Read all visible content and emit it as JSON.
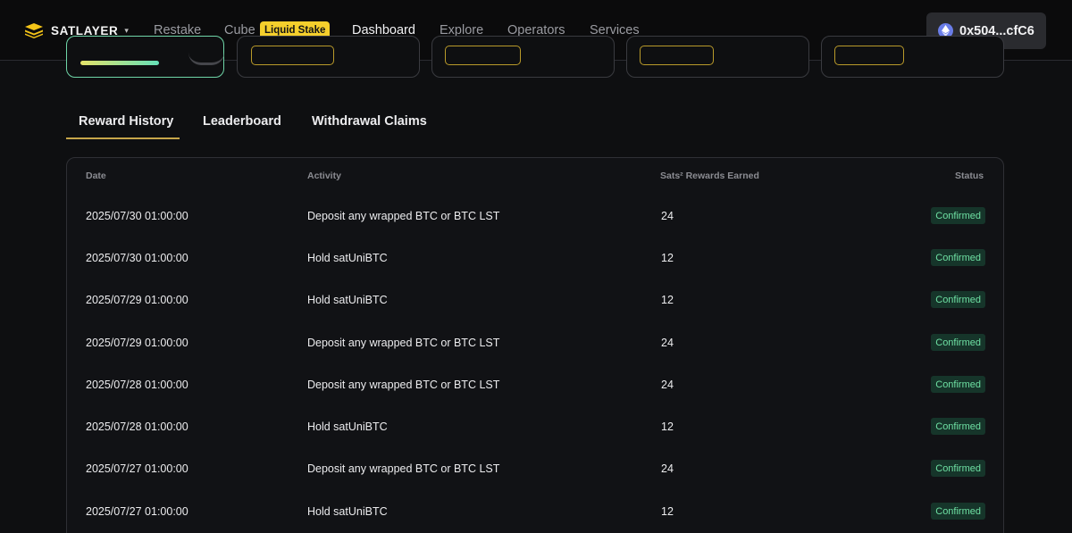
{
  "header": {
    "brand": "SATLAYER",
    "brand_caret": "▾",
    "nav": {
      "restake": "Restake",
      "cube": "Cube",
      "cube_badge": "Liquid Stake",
      "dashboard": "Dashboard",
      "explore": "Explore",
      "operators": "Operators",
      "services": "Services"
    },
    "wallet": "0x504...cfC6"
  },
  "tabs": {
    "reward_history": "Reward History",
    "leaderboard": "Leaderboard",
    "withdrawal_claims": "Withdrawal Claims"
  },
  "table": {
    "columns": {
      "date": "Date",
      "activity": "Activity",
      "rewards": "Sats² Rewards Earned",
      "status": "Status"
    },
    "rows": [
      {
        "date": "2025/07/30 01:00:00",
        "activity": "Deposit any wrapped BTC or BTC LST",
        "rewards": "24",
        "status": "Confirmed"
      },
      {
        "date": "2025/07/30 01:00:00",
        "activity": "Hold satUniBTC",
        "rewards": "12",
        "status": "Confirmed"
      },
      {
        "date": "2025/07/29 01:00:00",
        "activity": "Hold satUniBTC",
        "rewards": "12",
        "status": "Confirmed"
      },
      {
        "date": "2025/07/29 01:00:00",
        "activity": "Deposit any wrapped BTC or BTC LST",
        "rewards": "24",
        "status": "Confirmed"
      },
      {
        "date": "2025/07/28 01:00:00",
        "activity": "Deposit any wrapped BTC or BTC LST",
        "rewards": "24",
        "status": "Confirmed"
      },
      {
        "date": "2025/07/28 01:00:00",
        "activity": "Hold satUniBTC",
        "rewards": "12",
        "status": "Confirmed"
      },
      {
        "date": "2025/07/27 01:00:00",
        "activity": "Deposit any wrapped BTC or BTC LST",
        "rewards": "24",
        "status": "Confirmed"
      },
      {
        "date": "2025/07/27 01:00:00",
        "activity": "Hold satUniBTC",
        "rewards": "12",
        "status": "Confirmed"
      }
    ]
  },
  "colors": {
    "accent_yellow": "#f5cf2c",
    "status_green": "#6ee0a3",
    "tab_underline": "#c6a64a"
  },
  "icons": {
    "brand": "satlayer-logo-icon",
    "wallet": "ethereum-icon"
  }
}
